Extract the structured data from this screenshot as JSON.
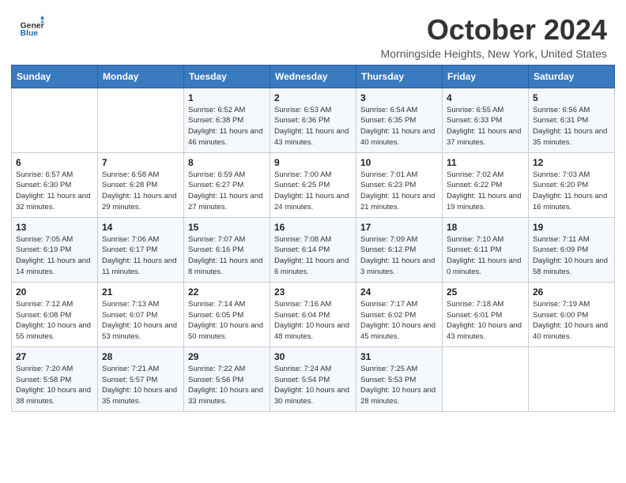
{
  "header": {
    "logo_line1": "General",
    "logo_line2": "Blue",
    "month_title": "October 2024",
    "subtitle": "Morningside Heights, New York, United States"
  },
  "days_of_week": [
    "Sunday",
    "Monday",
    "Tuesday",
    "Wednesday",
    "Thursday",
    "Friday",
    "Saturday"
  ],
  "weeks": [
    [
      {
        "day": "",
        "info": ""
      },
      {
        "day": "",
        "info": ""
      },
      {
        "day": "1",
        "info": "Sunrise: 6:52 AM\nSunset: 6:38 PM\nDaylight: 11 hours and 46 minutes."
      },
      {
        "day": "2",
        "info": "Sunrise: 6:53 AM\nSunset: 6:36 PM\nDaylight: 11 hours and 43 minutes."
      },
      {
        "day": "3",
        "info": "Sunrise: 6:54 AM\nSunset: 6:35 PM\nDaylight: 11 hours and 40 minutes."
      },
      {
        "day": "4",
        "info": "Sunrise: 6:55 AM\nSunset: 6:33 PM\nDaylight: 11 hours and 37 minutes."
      },
      {
        "day": "5",
        "info": "Sunrise: 6:56 AM\nSunset: 6:31 PM\nDaylight: 11 hours and 35 minutes."
      }
    ],
    [
      {
        "day": "6",
        "info": "Sunrise: 6:57 AM\nSunset: 6:30 PM\nDaylight: 11 hours and 32 minutes."
      },
      {
        "day": "7",
        "info": "Sunrise: 6:58 AM\nSunset: 6:28 PM\nDaylight: 11 hours and 29 minutes."
      },
      {
        "day": "8",
        "info": "Sunrise: 6:59 AM\nSunset: 6:27 PM\nDaylight: 11 hours and 27 minutes."
      },
      {
        "day": "9",
        "info": "Sunrise: 7:00 AM\nSunset: 6:25 PM\nDaylight: 11 hours and 24 minutes."
      },
      {
        "day": "10",
        "info": "Sunrise: 7:01 AM\nSunset: 6:23 PM\nDaylight: 11 hours and 21 minutes."
      },
      {
        "day": "11",
        "info": "Sunrise: 7:02 AM\nSunset: 6:22 PM\nDaylight: 11 hours and 19 minutes."
      },
      {
        "day": "12",
        "info": "Sunrise: 7:03 AM\nSunset: 6:20 PM\nDaylight: 11 hours and 16 minutes."
      }
    ],
    [
      {
        "day": "13",
        "info": "Sunrise: 7:05 AM\nSunset: 6:19 PM\nDaylight: 11 hours and 14 minutes."
      },
      {
        "day": "14",
        "info": "Sunrise: 7:06 AM\nSunset: 6:17 PM\nDaylight: 11 hours and 11 minutes."
      },
      {
        "day": "15",
        "info": "Sunrise: 7:07 AM\nSunset: 6:16 PM\nDaylight: 11 hours and 8 minutes."
      },
      {
        "day": "16",
        "info": "Sunrise: 7:08 AM\nSunset: 6:14 PM\nDaylight: 11 hours and 6 minutes."
      },
      {
        "day": "17",
        "info": "Sunrise: 7:09 AM\nSunset: 6:12 PM\nDaylight: 11 hours and 3 minutes."
      },
      {
        "day": "18",
        "info": "Sunrise: 7:10 AM\nSunset: 6:11 PM\nDaylight: 11 hours and 0 minutes."
      },
      {
        "day": "19",
        "info": "Sunrise: 7:11 AM\nSunset: 6:09 PM\nDaylight: 10 hours and 58 minutes."
      }
    ],
    [
      {
        "day": "20",
        "info": "Sunrise: 7:12 AM\nSunset: 6:08 PM\nDaylight: 10 hours and 55 minutes."
      },
      {
        "day": "21",
        "info": "Sunrise: 7:13 AM\nSunset: 6:07 PM\nDaylight: 10 hours and 53 minutes."
      },
      {
        "day": "22",
        "info": "Sunrise: 7:14 AM\nSunset: 6:05 PM\nDaylight: 10 hours and 50 minutes."
      },
      {
        "day": "23",
        "info": "Sunrise: 7:16 AM\nSunset: 6:04 PM\nDaylight: 10 hours and 48 minutes."
      },
      {
        "day": "24",
        "info": "Sunrise: 7:17 AM\nSunset: 6:02 PM\nDaylight: 10 hours and 45 minutes."
      },
      {
        "day": "25",
        "info": "Sunrise: 7:18 AM\nSunset: 6:01 PM\nDaylight: 10 hours and 43 minutes."
      },
      {
        "day": "26",
        "info": "Sunrise: 7:19 AM\nSunset: 6:00 PM\nDaylight: 10 hours and 40 minutes."
      }
    ],
    [
      {
        "day": "27",
        "info": "Sunrise: 7:20 AM\nSunset: 5:58 PM\nDaylight: 10 hours and 38 minutes."
      },
      {
        "day": "28",
        "info": "Sunrise: 7:21 AM\nSunset: 5:57 PM\nDaylight: 10 hours and 35 minutes."
      },
      {
        "day": "29",
        "info": "Sunrise: 7:22 AM\nSunset: 5:56 PM\nDaylight: 10 hours and 33 minutes."
      },
      {
        "day": "30",
        "info": "Sunrise: 7:24 AM\nSunset: 5:54 PM\nDaylight: 10 hours and 30 minutes."
      },
      {
        "day": "31",
        "info": "Sunrise: 7:25 AM\nSunset: 5:53 PM\nDaylight: 10 hours and 28 minutes."
      },
      {
        "day": "",
        "info": ""
      },
      {
        "day": "",
        "info": ""
      }
    ]
  ]
}
